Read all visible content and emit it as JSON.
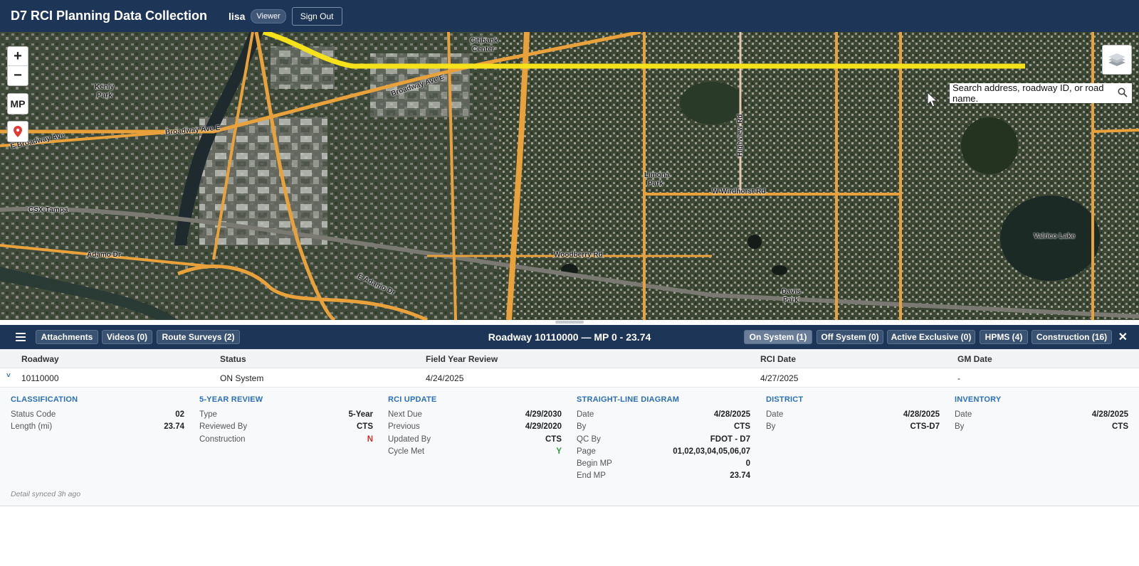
{
  "header": {
    "title": "D7 RCI Planning Data Collection",
    "username": "lisa",
    "role": "Viewer",
    "signout_label": "Sign Out"
  },
  "map": {
    "zoom_in": "+",
    "zoom_out": "−",
    "mp_label": "MP",
    "search_placeholder": "Search address, roadway ID, or road name.",
    "labels": {
      "citibank": "Citibank",
      "center": "Center",
      "kenly": "Kenly",
      "park": "Park",
      "broadway1": "Broadway Ave E",
      "broadway2": "Broadway Ave E",
      "broadway3": "E Broadway Ave",
      "csx": "CSX-Tampa",
      "adamo": "Adamo Dr",
      "eadamo": "E Adamo Dr",
      "woodberry": "Woodberry Rd",
      "limona": "Limona",
      "limona_park": "Park",
      "wirdhorst": "W Wirdhorst Rd",
      "highview": "Highview Rd",
      "valrico": "Valrico Lake",
      "davis": "Davis",
      "davis_park": "Park"
    }
  },
  "panel": {
    "title": "Roadway 10110000 — MP 0 - 23.74",
    "left_buttons": [
      "Attachments",
      "Videos (0)",
      "Route Surveys (2)"
    ],
    "right_buttons": [
      "On System (1)",
      "Off System (0)",
      "Active Exclusive (0)",
      "HPMS (4)",
      "Construction (16)"
    ],
    "close": "✕"
  },
  "grid": {
    "headers": [
      "Roadway",
      "Status",
      "Field Year Review",
      "RCI Date",
      "GM Date"
    ],
    "row": [
      "10110000",
      "ON System",
      "4/24/2025",
      "4/27/2025",
      "-"
    ],
    "expand_icon": "˅"
  },
  "detail": {
    "sections": [
      {
        "title": "CLASSIFICATION",
        "rows": [
          [
            "Status Code",
            "02"
          ],
          [
            "Length (mi)",
            "23.74"
          ]
        ]
      },
      {
        "title": "5-YEAR REVIEW",
        "rows": [
          [
            "Type",
            "5-Year"
          ],
          [
            "Reviewed By",
            "CTS"
          ],
          [
            "Construction",
            "N"
          ]
        ]
      },
      {
        "title": "RCI UPDATE",
        "rows": [
          [
            "Next Due",
            "4/29/2030"
          ],
          [
            "Previous",
            "4/29/2020"
          ],
          [
            "Updated By",
            "CTS"
          ],
          [
            "Cycle Met",
            "Y"
          ]
        ]
      },
      {
        "title": "STRAIGHT-LINE DIAGRAM",
        "rows": [
          [
            "Date",
            "4/28/2025"
          ],
          [
            "By",
            "CTS"
          ],
          [
            "QC By",
            "FDOT - D7"
          ],
          [
            "Page",
            "01,02,03,04,05,06,07"
          ],
          [
            "Begin MP",
            "0"
          ],
          [
            "End MP",
            "23.74"
          ]
        ]
      },
      {
        "title": "DISTRICT",
        "rows": [
          [
            "Date",
            "4/28/2025"
          ],
          [
            "By",
            "CTS-D7"
          ]
        ]
      },
      {
        "title": "INVENTORY",
        "rows": [
          [
            "Date",
            "4/28/2025"
          ],
          [
            "By",
            "CTS"
          ]
        ]
      }
    ],
    "synced": "Detail synced 3h ago"
  },
  "colors": {
    "header_bg": "#1d3557",
    "section_title": "#2a6fb8",
    "road": "#e9a23b",
    "highlight_road": "#f5e21a",
    "flag_red": "#d32f2f",
    "flag_green": "#2e9b3a"
  }
}
